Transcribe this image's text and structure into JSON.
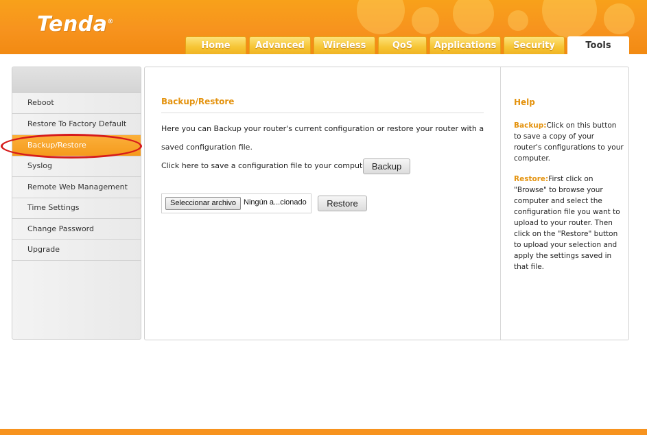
{
  "brand": {
    "logo_text": "Tenda",
    "logo_mark": "®"
  },
  "nav": {
    "tabs": [
      {
        "label": "Home"
      },
      {
        "label": "Advanced"
      },
      {
        "label": "Wireless"
      },
      {
        "label": "QoS"
      },
      {
        "label": "Applications"
      },
      {
        "label": "Security"
      },
      {
        "label": "Tools",
        "active": true
      }
    ]
  },
  "sidebar": {
    "items": [
      {
        "label": "Reboot"
      },
      {
        "label": "Restore To Factory Default"
      },
      {
        "label": "Backup/Restore",
        "active": true
      },
      {
        "label": "Syslog"
      },
      {
        "label": "Remote Web Management"
      },
      {
        "label": "Time Settings"
      },
      {
        "label": "Change Password"
      },
      {
        "label": "Upgrade"
      }
    ]
  },
  "main": {
    "title": "Backup/Restore",
    "intro_line1": "Here you can Backup your router's current configuration or restore your router with a",
    "intro_line2": "saved configuration file.",
    "save_prompt": "Click here to save a configuration file to your computer:",
    "backup_button": "Backup",
    "file_button": "Seleccionar archivo",
    "file_name": "Ningún a...cionado",
    "restore_button": "Restore"
  },
  "help": {
    "title": "Help",
    "backup_key": "Backup:",
    "backup_text": "Click on this button to save a copy of your router's configurations to your computer.",
    "restore_key": "Restore:",
    "restore_text": "First click on \"Browse\" to browse your computer and select the configuration file you want to upload to your router. Then click on the \"Restore\" button to   upload your selection and apply the settings saved in that file."
  },
  "colors": {
    "brand_orange": "#f7931e",
    "accent_heading": "#e4930f",
    "annotation_red": "#d61b1b"
  }
}
